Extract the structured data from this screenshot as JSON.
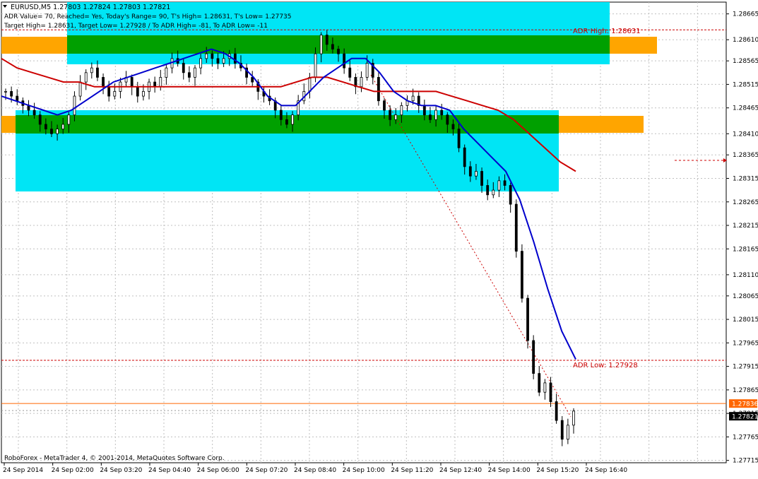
{
  "chart_data": {
    "type": "candlestick",
    "symbol_header": "EURUSD,M5  1.27803 1.27824 1.27803 1.27821",
    "info_line_1": "ADR Value= 70, Reached= Yes, Today's Range= 90, T's High= 1.28631, T's Low= 1.27735",
    "info_line_2": "Target High= 1.28631, Target Low= 1.27928 / To ADR High= -81, To ADR Low= -11",
    "copyright": "RoboForex - MetaTrader 4, © 2001-2014, MetaQuotes Software Corp.",
    "y_range": [
      1.2771,
      1.2869
    ],
    "y_ticks": [
      "1.28665",
      "1.28610",
      "1.28565",
      "1.28515",
      "1.28465",
      "1.28410",
      "1.28365",
      "1.28315",
      "1.28265",
      "1.28215",
      "1.28165",
      "1.28110",
      "1.28065",
      "1.28015",
      "1.27965",
      "1.27915",
      "1.27865",
      "1.27815",
      "1.27765",
      "1.27715"
    ],
    "x_labels": [
      "24 Sep 2014",
      "24 Sep 02:00",
      "24 Sep 03:20",
      "24 Sep 04:40",
      "24 Sep 06:00",
      "24 Sep 07:20",
      "24 Sep 08:40",
      "24 Sep 10:00",
      "24 Sep 11:20",
      "24 Sep 12:40",
      "24 Sep 14:00",
      "24 Sep 15:20",
      "24 Sep 16:40"
    ],
    "grid": true,
    "adr_high": {
      "label": "ADR High: 1.28631",
      "value": 1.28631
    },
    "adr_low": {
      "label": "ADR Low: 1.27928",
      "value": 1.27928
    },
    "ask_price": "1.27836",
    "bid_price": "1.27821",
    "colors": {
      "background": "#ffffff",
      "grid": "#c0c0c0",
      "candles": "#000000",
      "ma_fast": "#0000cc",
      "ma_slow": "#cc0000",
      "zone_outer": "#00e5f5",
      "zone_inner": "#00a000",
      "zone_side": "#ffa500",
      "adr_line": "#cc0000",
      "ask_line": "#ff6600"
    },
    "close_series": [
      1.285,
      1.2849,
      1.2848,
      1.2847,
      1.2846,
      1.2845,
      1.2843,
      1.2842,
      1.2841,
      1.2842,
      1.2843,
      1.2845,
      1.2849,
      1.2852,
      1.2854,
      1.2855,
      1.2853,
      1.2851,
      1.2849,
      1.285,
      1.2852,
      1.2853,
      1.2851,
      1.2849,
      1.285,
      1.2852,
      1.2851,
      1.2853,
      1.2855,
      1.2857,
      1.2856,
      1.2854,
      1.2853,
      1.2855,
      1.2857,
      1.2858,
      1.2857,
      1.2856,
      1.2857,
      1.2858,
      1.2856,
      1.2855,
      1.2853,
      1.2852,
      1.285,
      1.2849,
      1.2848,
      1.2846,
      1.2844,
      1.2843,
      1.2845,
      1.2848,
      1.285,
      1.2853,
      1.2858,
      1.2862,
      1.286,
      1.2859,
      1.2858,
      1.2855,
      1.2853,
      1.2851,
      1.2853,
      1.2856,
      1.2853,
      1.2848,
      1.2846,
      1.2844,
      1.2845,
      1.2847,
      1.2848,
      1.2849,
      1.2847,
      1.2845,
      1.2844,
      1.2846,
      1.2845,
      1.2843,
      1.2842,
      1.2838,
      1.2834,
      1.2832,
      1.2833,
      1.283,
      1.2828,
      1.2829,
      1.2831,
      1.283,
      1.2826,
      1.2816,
      1.2806,
      1.2797,
      1.279,
      1.2786,
      1.2788,
      1.2784,
      1.278,
      1.2776,
      1.2779,
      1.2782
    ],
    "ma_fast_series": [
      1.2849,
      1.2848,
      1.2847,
      1.2846,
      1.2845,
      1.2846,
      1.2848,
      1.285,
      1.2852,
      1.2853,
      1.2854,
      1.2855,
      1.2856,
      1.2857,
      1.2858,
      1.2859,
      1.2858,
      1.2856,
      1.2853,
      1.2849,
      1.2847,
      1.2847,
      1.285,
      1.2853,
      1.2855,
      1.2857,
      1.2857,
      1.2854,
      1.285,
      1.2848,
      1.2847,
      1.2847,
      1.2846,
      1.2842,
      1.2839,
      1.2836,
      1.2833,
      1.2827,
      1.2818,
      1.2808,
      1.2799,
      1.2793
    ],
    "ma_slow_series": [
      1.2857,
      1.2855,
      1.2854,
      1.2853,
      1.2852,
      1.2852,
      1.2851,
      1.2851,
      1.2851,
      1.2851,
      1.2851,
      1.2851,
      1.2851,
      1.2851,
      1.2851,
      1.2851,
      1.2851,
      1.2851,
      1.2851,
      1.2852,
      1.2853,
      1.2853,
      1.2852,
      1.2851,
      1.285,
      1.285,
      1.285,
      1.285,
      1.285,
      1.2849,
      1.2848,
      1.2847,
      1.2846,
      1.2844,
      1.2841,
      1.2838,
      1.2835,
      1.2833
    ]
  }
}
